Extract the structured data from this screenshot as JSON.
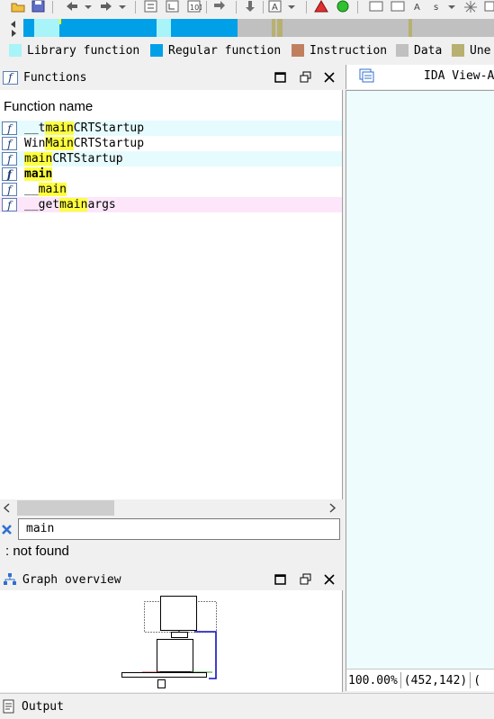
{
  "colors": {
    "library": "#a8f4f8",
    "regular": "#00a0e8",
    "instruction": "#c08060",
    "data": "#c0c0c0",
    "unexplored": "#b8b070",
    "highlight": "#ffff40",
    "row_library": "#e6fbfd",
    "row_selected": "#fde6fa",
    "ida_background": "#eefcfd"
  },
  "legend": [
    {
      "label": "Library function",
      "color": "#a8f4f8"
    },
    {
      "label": "Regular function",
      "color": "#00a0e8"
    },
    {
      "label": "Instruction",
      "color": "#c08060"
    },
    {
      "label": "Data",
      "color": "#c0c0c0"
    },
    {
      "label": "Une",
      "color": "#b8b070"
    }
  ],
  "functions_panel": {
    "title": "Functions",
    "icon": "function-icon",
    "column_header": "Function name",
    "rows": [
      {
        "pre": "__t",
        "match": "main",
        "post": "CRTStartup",
        "kind": "library"
      },
      {
        "pre": "Win",
        "match": "Main",
        "post": "CRTStartup",
        "kind": "regular"
      },
      {
        "pre": "",
        "match": "main",
        "post": "CRTStartup",
        "kind": "library"
      },
      {
        "pre": "",
        "match": "main",
        "post": "",
        "kind": "regular",
        "bold": true
      },
      {
        "pre": "__",
        "match": "main",
        "post": "",
        "kind": "regular"
      },
      {
        "pre": "__get",
        "match": "main",
        "post": "args",
        "kind": "selected"
      }
    ]
  },
  "search": {
    "value": "main",
    "status": ": not found"
  },
  "graph_panel": {
    "title": "Graph overview"
  },
  "ida_view": {
    "tab_label": "IDA View-A",
    "zoom": "100.00%",
    "coords": "(452,142)",
    "extra": "("
  },
  "output_panel": {
    "title": "Output"
  }
}
